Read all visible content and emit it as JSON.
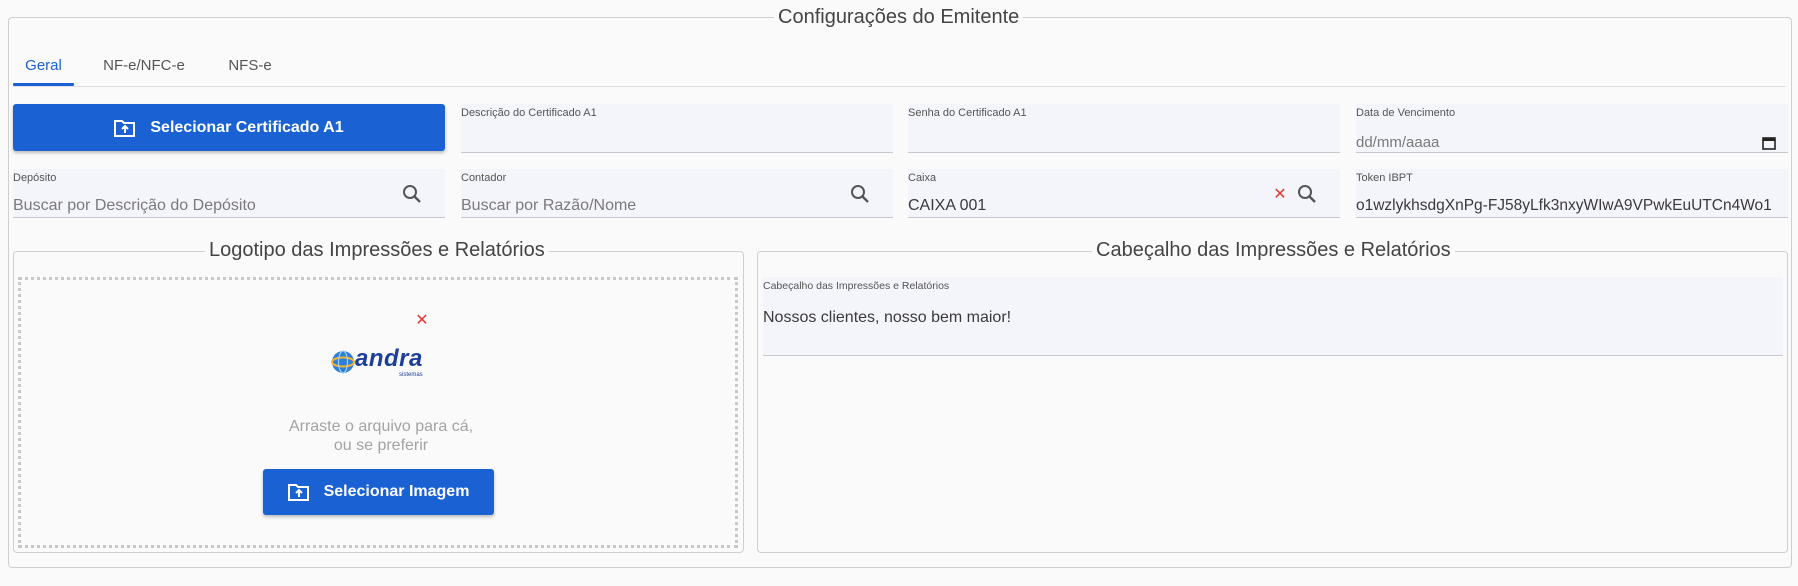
{
  "section_title": "Configurações do Emitente",
  "tabs": [
    {
      "label": "Geral",
      "active": true
    },
    {
      "label": "NF-e/NFC-e",
      "active": false
    },
    {
      "label": "NFS-e",
      "active": false
    }
  ],
  "certificate_button": {
    "label": "Selecionar Certificado A1",
    "icon": "upload-folder-icon"
  },
  "fields": {
    "certificate_description": {
      "label": "Descrição do Certificado A1",
      "value": ""
    },
    "certificate_password": {
      "label": "Senha do Certificado A1",
      "value": ""
    },
    "expiry_date": {
      "label": "Data de Vencimento",
      "value": "dd/mm/aaaa",
      "icon": "calendar-icon"
    },
    "deposit": {
      "label": "Depósito",
      "placeholder": "Buscar por Descrição do Depósito",
      "icon": "search-icon"
    },
    "accountant": {
      "label": "Contador",
      "placeholder": "Buscar por Razão/Nome",
      "icon": "search-icon"
    },
    "cash_register": {
      "label": "Caixa",
      "value": "CAIXA 001",
      "icon": "search-icon",
      "clear_icon": "close-icon"
    },
    "ibpt_token": {
      "label": "Token IBPT",
      "value": "o1wzlykhsdgXnPg-FJ58yLfk3nxyWIwA9VPwkEuUTCn4Wo1"
    }
  },
  "logo_section": {
    "title": "Logotipo das Impressões e Relatórios",
    "logo_text": "andra",
    "logo_subtext": "sistemas",
    "drop_text_line1": "Arraste o arquivo para cá,",
    "drop_text_line2": "ou se preferir",
    "select_button_label": "Selecionar Imagem"
  },
  "header_section": {
    "title": "Cabeçalho das Impressões e Relatórios",
    "field_label": "Cabeçalho das Impressões e Relatórios",
    "field_value": "Nossos clientes, nosso bem maior!"
  },
  "colors": {
    "primary": "#1a62d3",
    "field_bg": "#f4f4fb",
    "clear_red": "#e53935"
  }
}
